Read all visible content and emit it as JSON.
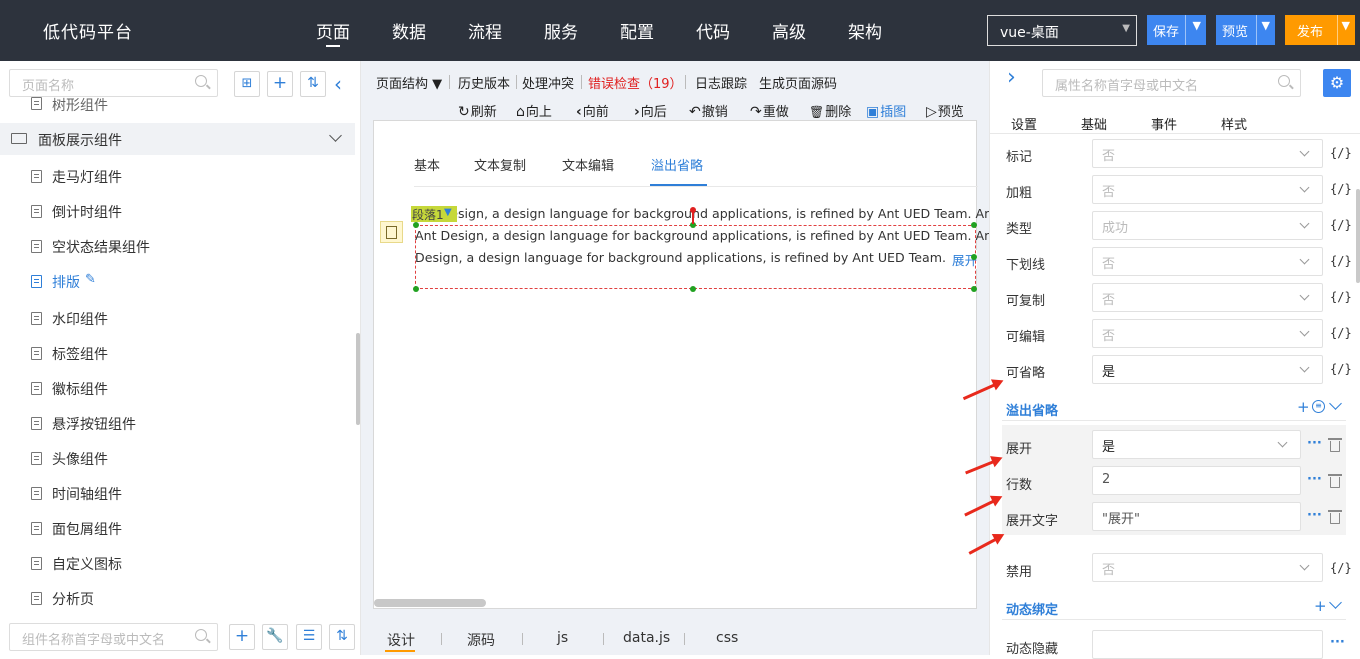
{
  "app": {
    "title": "低代码平台"
  },
  "nav": {
    "items": [
      "页面",
      "数据",
      "流程",
      "服务",
      "配置",
      "代码",
      "高级",
      "架构"
    ],
    "active": "页面"
  },
  "header": {
    "env": "vue-桌面",
    "save": "保存",
    "preview": "预览",
    "publish": "发布"
  },
  "colors": {
    "topbar": "#2d333d",
    "accent": "#2f7fd8",
    "publish": "#ff9a00",
    "save": "#3d86f0",
    "error": "#e02020"
  },
  "left": {
    "search_placeholder": "页面名称",
    "group": "面板展示组件",
    "partial_item": "树形组件",
    "items": [
      "走马灯组件",
      "倒计时组件",
      "空状态结果组件",
      "排版",
      "水印组件",
      "标签组件",
      "徽标组件",
      "悬浮按钮组件",
      "头像组件",
      "时间轴组件",
      "面包屑组件",
      "自定义图标",
      "分析页"
    ],
    "active_item": "排版",
    "component_search_placeholder": "组件名称首字母或中文名"
  },
  "toolbar": {
    "row1": [
      "页面结构 ▼",
      "历史版本",
      "处理冲突",
      "错误检查（19）",
      "日志跟踪",
      "生成页面源码"
    ],
    "row2": [
      {
        "icon": "↻",
        "label": "刷新"
      },
      {
        "icon": "⌂",
        "label": "向上"
      },
      {
        "icon": "‹",
        "label": "向前"
      },
      {
        "icon": "›",
        "label": "向后"
      },
      {
        "icon": "↶",
        "label": "撤销"
      },
      {
        "icon": "↷",
        "label": "重做"
      },
      {
        "icon": "🗑",
        "label": "删除"
      },
      {
        "icon": "▣",
        "label": "插图"
      },
      {
        "icon": "▷",
        "label": "预览"
      }
    ]
  },
  "canvas": {
    "tabs": [
      "基本",
      "文本复制",
      "文本编辑",
      "溢出省略"
    ],
    "active_tab": "溢出省略",
    "badge": "段落1",
    "lines": [
      "Ant Design, a design language for background applications, is refined by Ant UED Team. Ant",
      "Ant Design, a design language for background applications, is refined by Ant UED Team. Ant",
      "Design, a design language for background applications, is refined by Ant UED Team. A..."
    ],
    "expand": "展开"
  },
  "bottom_tabs": [
    "设计",
    "源码",
    "js",
    "data.js",
    "css"
  ],
  "right": {
    "search_placeholder": "属性名称首字母或中文名",
    "tabs": [
      "设置",
      "基础",
      "事件",
      "样式"
    ],
    "props": [
      {
        "label": "标记",
        "value": "否"
      },
      {
        "label": "加粗",
        "value": "否"
      },
      {
        "label": "类型",
        "value": "成功"
      },
      {
        "label": "下划线",
        "value": "否"
      },
      {
        "label": "可复制",
        "value": "否"
      },
      {
        "label": "可编辑",
        "value": "否"
      },
      {
        "label": "可省略",
        "value": "是"
      }
    ],
    "code_icon": "{/}",
    "section_overflow": "溢出省略",
    "overflow": [
      {
        "label": "展开",
        "value": "是"
      },
      {
        "label": "行数",
        "value": "2"
      },
      {
        "label": "展开文字",
        "value": "\"展开\""
      }
    ],
    "disabled": {
      "label": "禁用",
      "value": "否"
    },
    "section_binding": "动态绑定",
    "binding": {
      "label": "动态隐藏"
    }
  }
}
